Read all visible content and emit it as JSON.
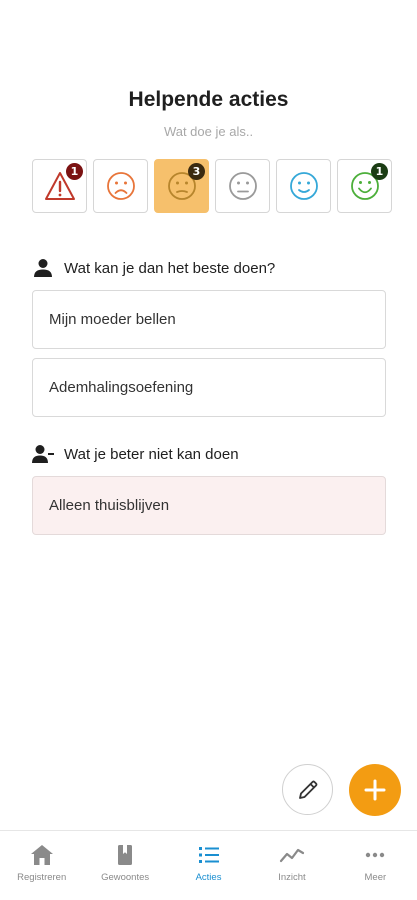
{
  "header": {
    "title": "Helpende acties",
    "subtitle": "Wat doe je als.."
  },
  "moods": [
    {
      "icon": "warning-icon",
      "color": "#c0392b",
      "badge": "1",
      "badge_color": "#7b1212",
      "selected": false
    },
    {
      "icon": "sad-face-icon",
      "color": "#e8753a",
      "badge": "",
      "badge_color": "",
      "selected": false
    },
    {
      "icon": "uneasy-face-icon",
      "color": "#b7852c",
      "badge": "3",
      "badge_color": "#3b2a10",
      "selected": true
    },
    {
      "icon": "neutral-face-icon",
      "color": "#9a9a9a",
      "badge": "",
      "badge_color": "",
      "selected": false
    },
    {
      "icon": "smile-face-icon",
      "color": "#35a8d8",
      "badge": "",
      "badge_color": "",
      "selected": false
    },
    {
      "icon": "happy-face-icon",
      "color": "#4caf3a",
      "badge": "1",
      "badge_color": "#1b3d14",
      "selected": false
    }
  ],
  "helpful": {
    "heading": "Wat kan je dan het beste doen?",
    "items": [
      "Mijn moeder bellen",
      "Ademhalingsoefening"
    ]
  },
  "unhelpful": {
    "heading": "Wat je beter niet kan doen",
    "items": [
      "Alleen thuisblijven"
    ]
  },
  "colors": {
    "accent": "#f39c12",
    "selected_mood": "#f6c06c",
    "nav_active": "#1a8fd1",
    "negative_card": "#fbf0f0"
  },
  "nav": [
    {
      "label": "Registreren",
      "icon": "home-icon",
      "active": false
    },
    {
      "label": "Gewoontes",
      "icon": "bookmark-icon",
      "active": false
    },
    {
      "label": "Acties",
      "icon": "list-icon",
      "active": true
    },
    {
      "label": "Inzicht",
      "icon": "chart-line-icon",
      "active": false
    },
    {
      "label": "Meer",
      "icon": "more-dots-icon",
      "active": false
    }
  ]
}
